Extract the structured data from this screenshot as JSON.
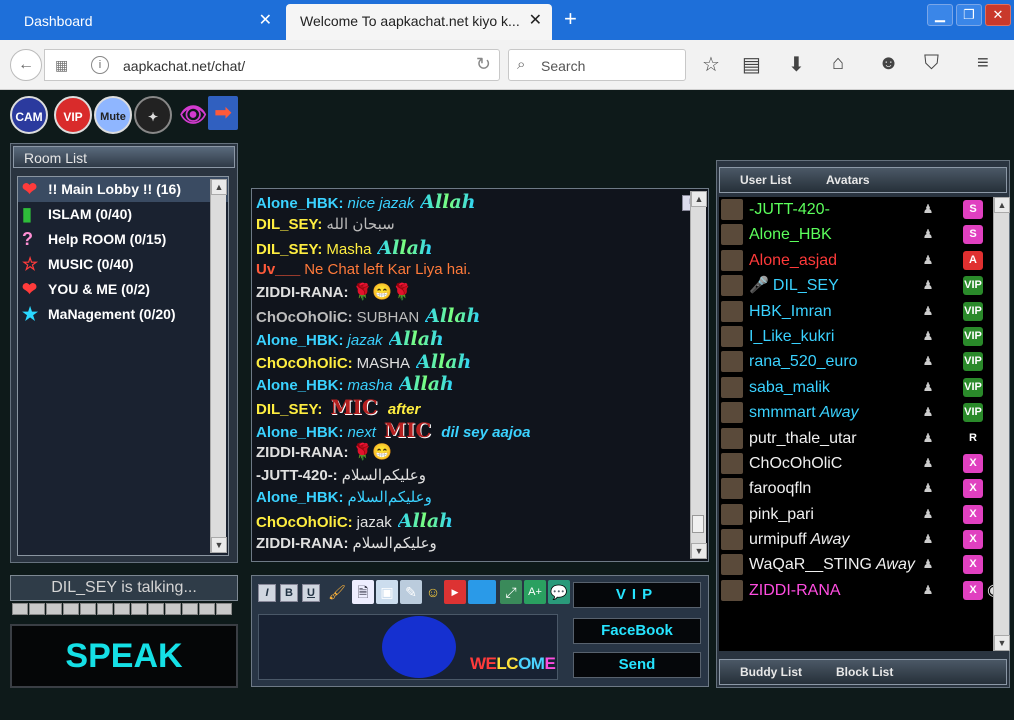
{
  "browser": {
    "tabs": [
      {
        "label": "Dashboard"
      },
      {
        "label": "Welcome To aapkachat.net kiyo k..."
      }
    ],
    "url": "aapkachat.net/chat/",
    "search_placeholder": "Search",
    "tab_close": "✕",
    "new_tab": "+"
  },
  "toolbar_icons": {
    "cam": "CAM",
    "vip": "VIP",
    "mute": "Mute"
  },
  "rooms": {
    "header": "Room List",
    "items": [
      {
        "label": "!! Main Lobby  !! (16)",
        "icon": "heart-icon",
        "glyph": "❤",
        "color": "#ff3b3b",
        "selected": true
      },
      {
        "label": "ISLAM (0/40)",
        "icon": "book-icon",
        "glyph": "▮",
        "color": "#2ebd3a"
      },
      {
        "label": "Help ROOM (0/15)",
        "icon": "question-icon",
        "glyph": "?",
        "color": "#ff8fd4"
      },
      {
        "label": "MUSIC (0/40)",
        "icon": "star-outline-icon",
        "glyph": "☆",
        "color": "#ff3b3b"
      },
      {
        "label": "YOU & ME (0/2)",
        "icon": "heart-icon",
        "glyph": "❤",
        "color": "#ff3b3b"
      },
      {
        "label": "MaNagement (0/20)",
        "icon": "star-icon",
        "glyph": "★",
        "color": "#2ad8ff"
      }
    ]
  },
  "talking": "DIL_SEY is talking...",
  "speak_label": "SPEAK",
  "chat": [
    {
      "name": "Alone_HBK:",
      "nc": "#3ad2ff",
      "text": "nice jazak",
      "tc": "#3ad2ff",
      "it": true,
      "glitter": "Allah"
    },
    {
      "name": "DIL_SEY:",
      "nc": "#ffee40",
      "text": "سبحان الله",
      "tc": "#bbbbbb",
      "it": false
    },
    {
      "name": "DIL_SEY:",
      "nc": "#ffee40",
      "text": "Masha",
      "tc": "#ffee40",
      "it": false,
      "glitter": "Allah"
    },
    {
      "name": "Uv___",
      "nc": "#ff5a3a",
      "text": "Ne Chat left Kar Liya hai.",
      "tc": "#ff7a3a",
      "it": false
    },
    {
      "name": "ZIDDI-RANA:",
      "nc": "#e0e0e0",
      "text": "",
      "tc": "#e0e0e0",
      "it": false,
      "emoji": "🌹😁🌹"
    },
    {
      "name": "ChOcOhOliC:",
      "nc": "#bdbdbd",
      "text": "SUBHAN",
      "tc": "#bdbdbd",
      "it": false,
      "glitter": "Allah"
    },
    {
      "name": "Alone_HBK:",
      "nc": "#3ad2ff",
      "text": "jazak",
      "tc": "#3ad2ff",
      "it": true,
      "glitter": "Allah"
    },
    {
      "name": "ChOcOhOliC:",
      "nc": "#ffee40",
      "text": "MASHA",
      "tc": "#e0e0e0",
      "it": false,
      "glitter": "Allah"
    },
    {
      "name": "Alone_HBK:",
      "nc": "#3ad2ff",
      "text": "masha",
      "tc": "#3ad2ff",
      "it": true,
      "glitter": "Allah"
    },
    {
      "name": "DIL_SEY:",
      "nc": "#ffee40",
      "text": "",
      "tc": "#ffee40",
      "it": false,
      "mic": "MIC",
      "after": "after"
    },
    {
      "name": "Alone_HBK:",
      "nc": "#3ad2ff",
      "text": "next",
      "tc": "#3ad2ff",
      "it": true,
      "mic": "MIC",
      "after": "dil sey aajoa"
    },
    {
      "name": "ZIDDI-RANA:",
      "nc": "#e0e0e0",
      "text": "",
      "tc": "#e0e0e0",
      "it": false,
      "emoji": "🌹😁"
    },
    {
      "name": "-JUTT-420-:",
      "nc": "#e0e0e0",
      "text": "وعلیکم‌السلام",
      "tc": "#e0e0e0",
      "it": false
    },
    {
      "name": "Alone_HBK:",
      "nc": "#3ad2ff",
      "text": "وعلیکم‌السلام",
      "tc": "#3ad2ff",
      "it": false
    },
    {
      "name": "ChOcOhOliC:",
      "nc": "#ffee40",
      "text": "jazak",
      "tc": "#e0e0e0",
      "it": false,
      "glitter": "Allah"
    },
    {
      "name": "ZIDDI-RANA:",
      "nc": "#e0e0e0",
      "text": "وعلیکم‌السلام",
      "tc": "#e0e0e0",
      "it": false
    }
  ],
  "composer": {
    "input_value": "",
    "welcome": [
      "WE",
      "LC",
      "OM",
      "E"
    ],
    "vip": "VIP",
    "facebook": "FaceBook",
    "send": "Send"
  },
  "users": {
    "tab_user_list": "User List",
    "tab_avatars": "Avatars",
    "tab_buddy_list": "Buddy List",
    "tab_block_list": "Block List",
    "away_label": "Away",
    "items": [
      {
        "name": "-JUTT-420-",
        "color": "#5cff5c",
        "badge": "S",
        "bcolor": "#e040c0"
      },
      {
        "name": "Alone_HBK",
        "color": "#5cff5c",
        "badge": "S",
        "bcolor": "#e040c0"
      },
      {
        "name": "Alone_asjad",
        "color": "#ff3a3a",
        "badge": "A",
        "bcolor": "#e03030"
      },
      {
        "name": "DIL_SEY",
        "color": "#3ad2ff",
        "badge": "VIP",
        "bcolor": "#2a8a2a",
        "mic": true
      },
      {
        "name": "HBK_Imran",
        "color": "#3ad2ff",
        "badge": "VIP",
        "bcolor": "#2a8a2a"
      },
      {
        "name": "I_Like_kukri",
        "color": "#3ad2ff",
        "badge": "VIP",
        "bcolor": "#2a8a2a"
      },
      {
        "name": "rana_520_euro",
        "color": "#3ad2ff",
        "badge": "VIP",
        "bcolor": "#2a8a2a"
      },
      {
        "name": "saba_malik",
        "color": "#3ad2ff",
        "badge": "VIP",
        "bcolor": "#2a8a2a"
      },
      {
        "name": "smmmart",
        "color": "#3ad2ff",
        "badge": "VIP",
        "bcolor": "#2a8a2a",
        "away": true
      },
      {
        "name": "putr_thale_utar",
        "color": "#f0f0f0",
        "badge": "R",
        "bcolor": "#000"
      },
      {
        "name": "ChOcOhOliC",
        "color": "#f0f0f0",
        "badge": "X",
        "bcolor": "#e040c0"
      },
      {
        "name": "farooqfln",
        "color": "#f0f0f0",
        "badge": "X",
        "bcolor": "#e040c0"
      },
      {
        "name": "pink_pari",
        "color": "#f0f0f0",
        "badge": "X",
        "bcolor": "#e040c0"
      },
      {
        "name": "urmipuff",
        "color": "#f0f0f0",
        "badge": "X",
        "bcolor": "#e040c0",
        "away": true
      },
      {
        "name": "WaQaR__STING",
        "color": "#f0f0f0",
        "badge": "X",
        "bcolor": "#e040c0",
        "away": true
      },
      {
        "name": "ZIDDI-RANA",
        "color": "#ff4de0",
        "badge": "X",
        "bcolor": "#e040c0",
        "webcam": true
      }
    ]
  }
}
